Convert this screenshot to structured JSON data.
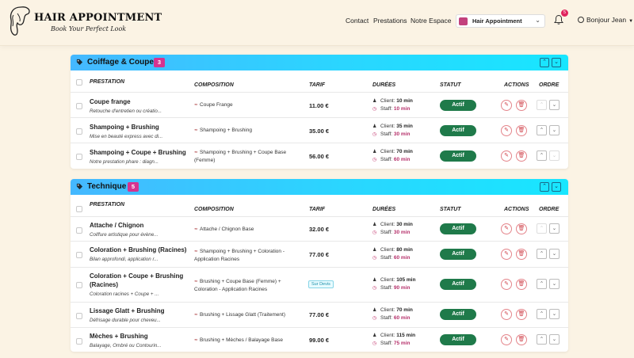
{
  "app": {
    "logo_title": "HAIR APPOINTMENT",
    "logo_subtitle": "Book Your Perfect Look"
  },
  "nav": {
    "contact": "Contact",
    "prestations": "Prestations",
    "espace": "Notre Espace"
  },
  "salon_select": {
    "value": "Hair Appointment"
  },
  "notifications": {
    "count": "5"
  },
  "user": {
    "greeting": "Bonjour Jean"
  },
  "columns": {
    "prestation": "PRESTATION",
    "composition": "COMPOSITION",
    "tarif": "TARIF",
    "durees": "DURÉES",
    "statut": "STATUT",
    "actions": "ACTIONS",
    "ordre": "ORDRE"
  },
  "labels": {
    "client": "Client:",
    "staff": "Staff:",
    "actif": "Actif",
    "sur_devis": "Sur Devis"
  },
  "colors": {
    "accent": "#d6338f",
    "header_gradient_start": "#45b8ff",
    "header_gradient_end": "#18e6ff",
    "status_active": "#1f7a4a",
    "staff_time": "#b5306a"
  },
  "sections": [
    {
      "title": "Coiffage & Coupe",
      "count": "3",
      "items": [
        {
          "name": "Coupe frange",
          "description": "Retouche d'entretien ou créatio...",
          "composition": "Coupe Frange",
          "price": "11.00 €",
          "client_time": "10 min",
          "staff_time": "10 min"
        },
        {
          "name": "Shampoing + Brushing",
          "description": "Mise en beauté express avec di...",
          "composition": "Shampoing + Brushing",
          "price": "35.00 €",
          "client_time": "35 min",
          "staff_time": "30 min"
        },
        {
          "name": "Shampoing + Coupe + Brushing",
          "description": "Notre prestation phare : diagn...",
          "composition": "Shampoing + Brushing + Coupe Base (Femme)",
          "price": "56.00 €",
          "client_time": "70 min",
          "staff_time": "60 min"
        }
      ]
    },
    {
      "title": "Technique",
      "count": "5",
      "items": [
        {
          "name": "Attache / Chignon",
          "description": "Coiffure artistique pour évène...",
          "composition": "Attache / Chignon Base",
          "price": "32.00 €",
          "client_time": "30 min",
          "staff_time": "30 min"
        },
        {
          "name": "Coloration + Brushing (Racines)",
          "description": "Bilan approfondi, application r...",
          "composition": "Shampoing + Brushing + Coloration - Application Racines",
          "price": "77.00 €",
          "client_time": "80 min",
          "staff_time": "60 min"
        },
        {
          "name": "Coloration + Coupe + Brushing (Racines)",
          "description": "Coloration racines + Coupe + ...",
          "composition": "Brushing + Coupe Base (Femme) + Coloration - Application Racines",
          "price": "",
          "price_badge": "Sur Devis",
          "client_time": "105 min",
          "staff_time": "90 min"
        },
        {
          "name": "Lissage Glatt + Brushing",
          "description": "Défrisage durable pour cheveu...",
          "composition": "Brushing + Lissage Glatt (Traitement)",
          "price": "77.00 €",
          "client_time": "70 min",
          "staff_time": "60 min"
        },
        {
          "name": "Mèches + Brushing",
          "description": "Balayage, Ombré ou Contourin...",
          "composition": "Brushing + Mèches / Balayage Base",
          "price": "99.00 €",
          "client_time": "115 min",
          "staff_time": "75 min"
        }
      ]
    }
  ]
}
